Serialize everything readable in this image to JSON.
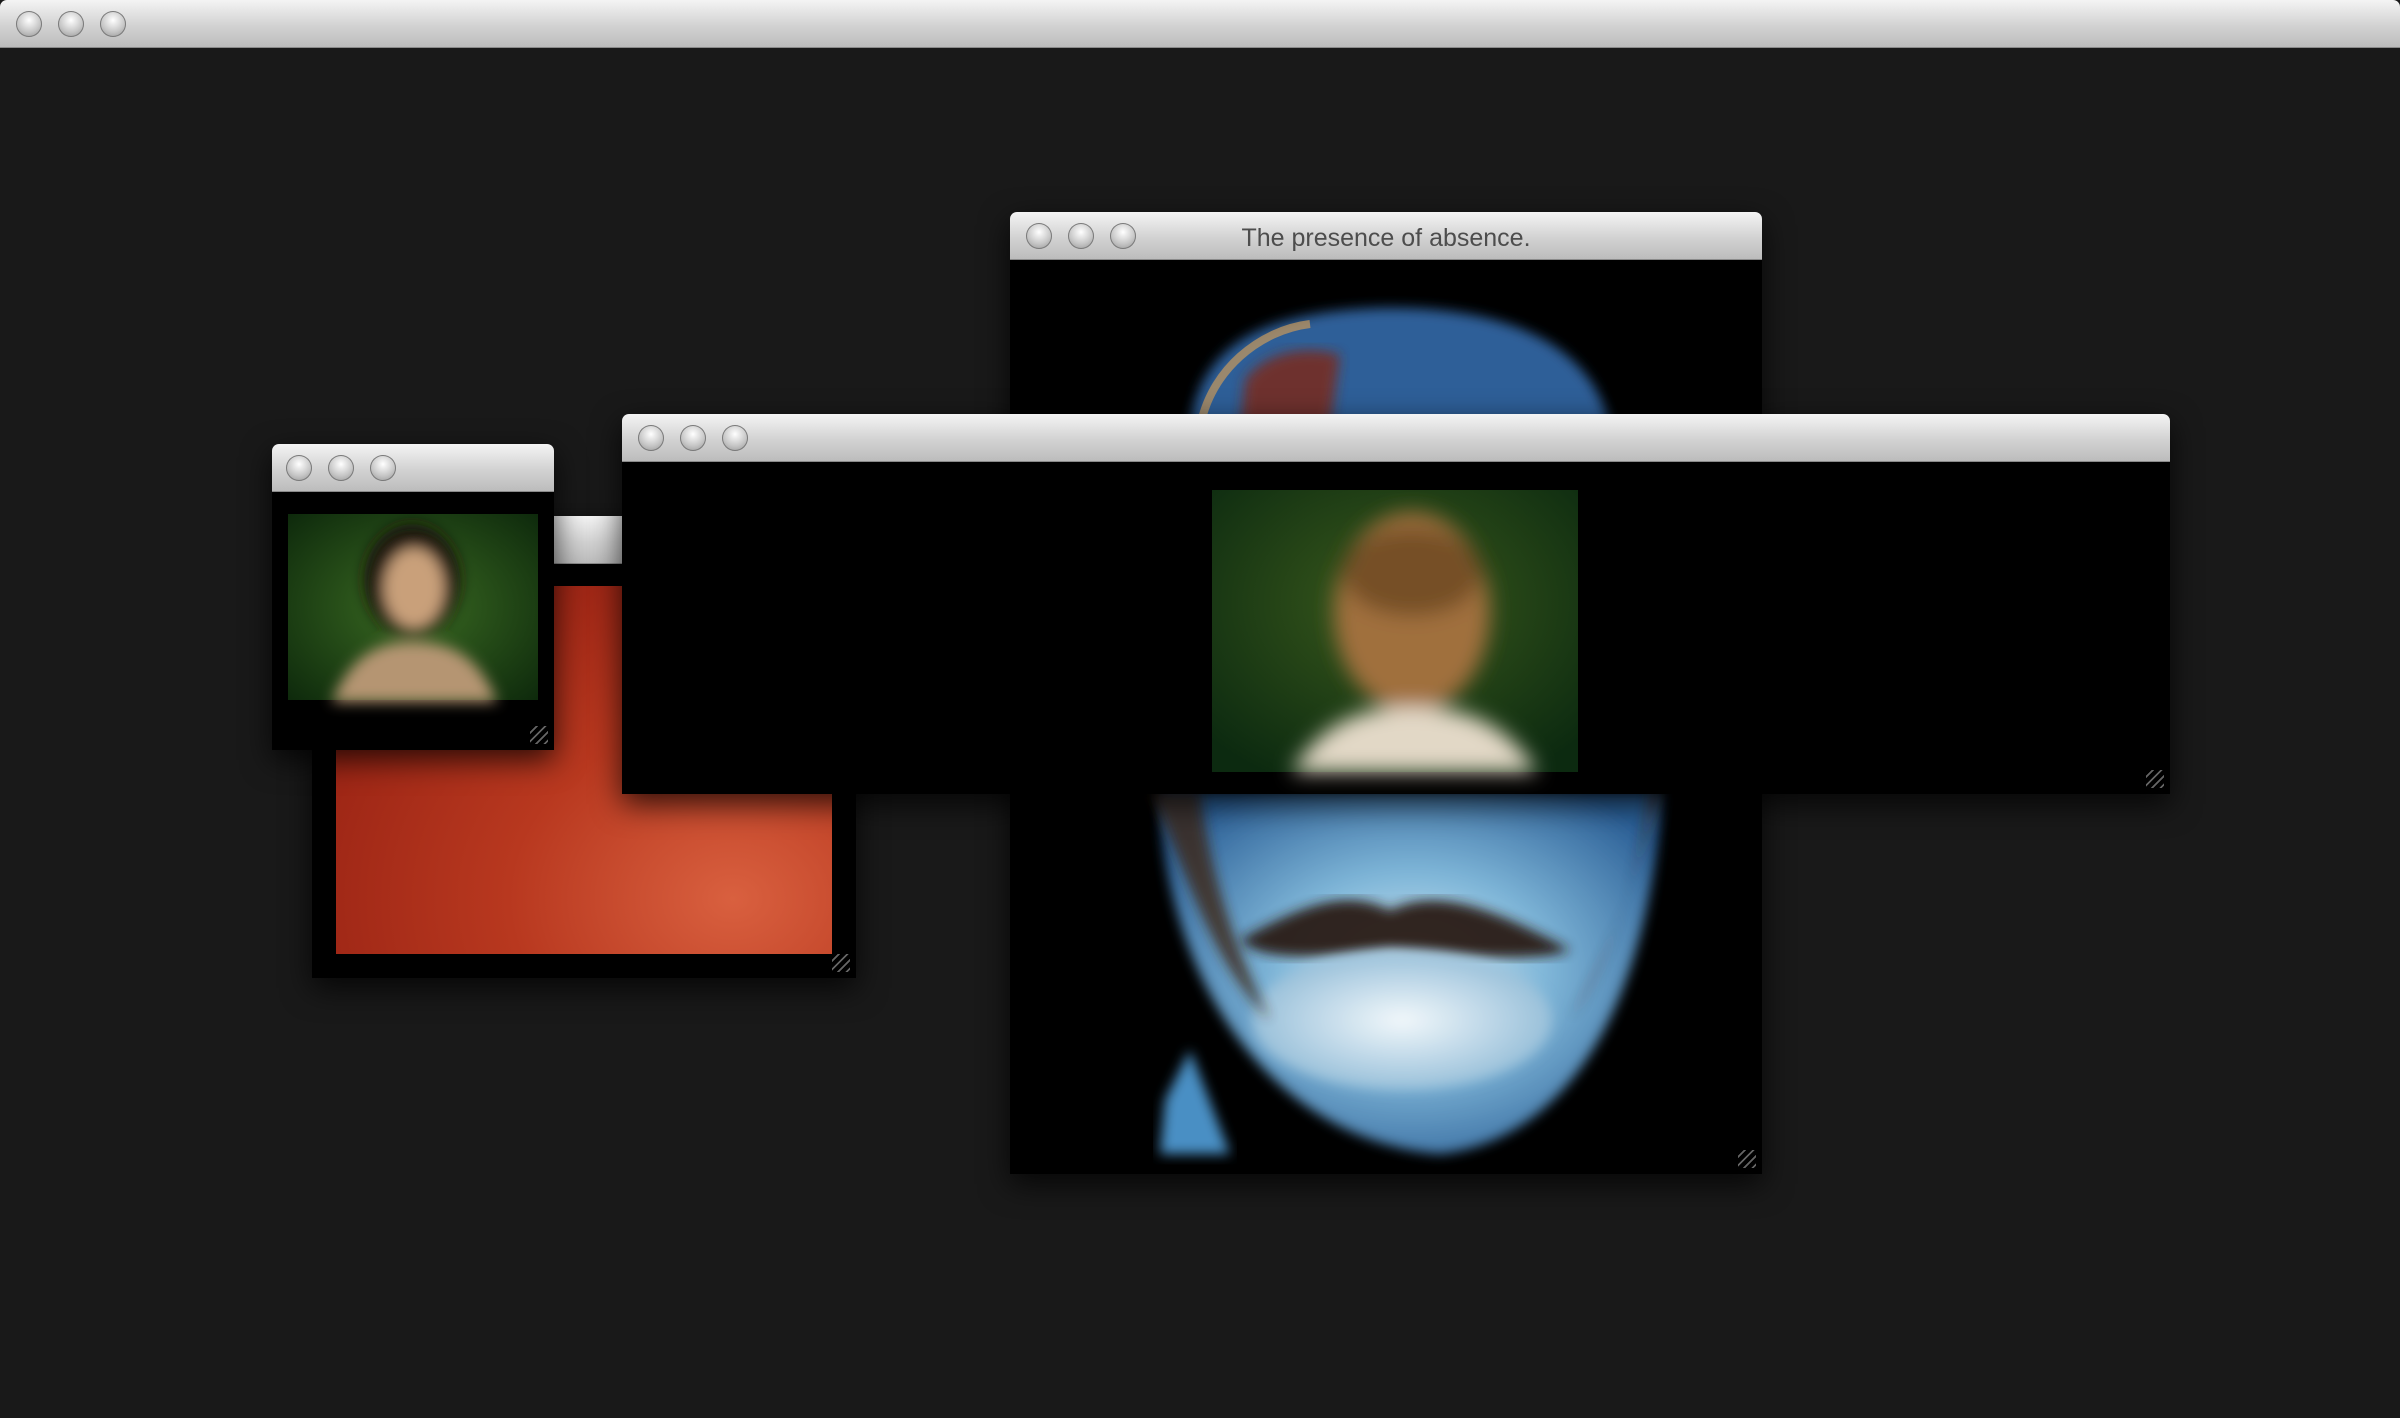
{
  "desktop": {
    "background": "#191919"
  },
  "windows": {
    "main_frame": {
      "title": ""
    },
    "face_negative": {
      "title": "The presence of absence."
    },
    "red_gradient": {
      "title": ""
    },
    "woman_portrait": {
      "title": ""
    },
    "man_portrait": {
      "title": ""
    }
  },
  "icons": [
    "close-icon",
    "minimize-icon",
    "zoom-icon",
    "resize-grip-icon"
  ],
  "colors": {
    "titlebar_top": "#f4f4f4",
    "titlebar_bottom": "#bcbcbc",
    "red_gradient_start": "#8c1a0f",
    "red_gradient_end": "#d2553a",
    "negative_blue": "#3f7fbf"
  }
}
